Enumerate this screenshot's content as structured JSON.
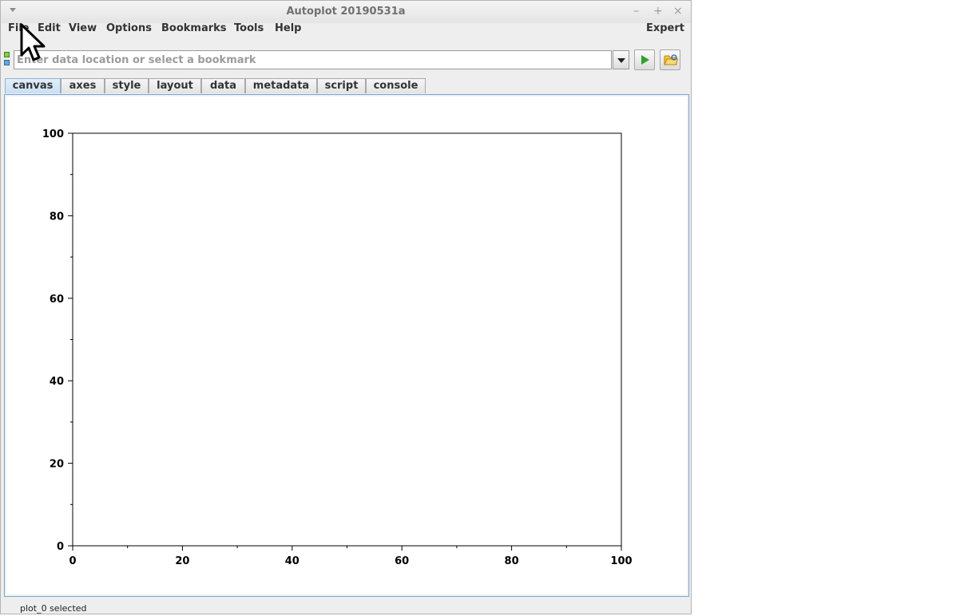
{
  "window": {
    "title": "Autoplot 20190531a"
  },
  "menubar": {
    "items": [
      "File",
      "Edit",
      "View",
      "Options",
      "Bookmarks",
      "Tools",
      "Help"
    ],
    "expert_label": "Expert"
  },
  "urlbar": {
    "placeholder": "Enter data location or select a bookmark"
  },
  "tabs": [
    "canvas",
    "axes",
    "style",
    "layout",
    "data",
    "metadata",
    "script",
    "console"
  ],
  "active_tab": "canvas",
  "chart_data": {
    "type": "scatter",
    "xlim": [
      0,
      100
    ],
    "ylim": [
      0,
      100
    ],
    "x_ticks": [
      "0",
      "20",
      "40",
      "60",
      "80",
      "100"
    ],
    "y_ticks": [
      "0",
      "20",
      "40",
      "60",
      "80",
      "100"
    ],
    "x_minor_ticks": [
      10,
      30,
      50,
      70,
      90
    ],
    "y_minor_ticks": [
      10,
      30,
      50,
      70,
      90
    ],
    "series": [],
    "grid": false
  },
  "status": {
    "text": "plot_0 selected"
  },
  "colors": {
    "play": "#2fa12f",
    "active_tab": "#c8dff5",
    "canvas_border": "#7da4cc"
  }
}
